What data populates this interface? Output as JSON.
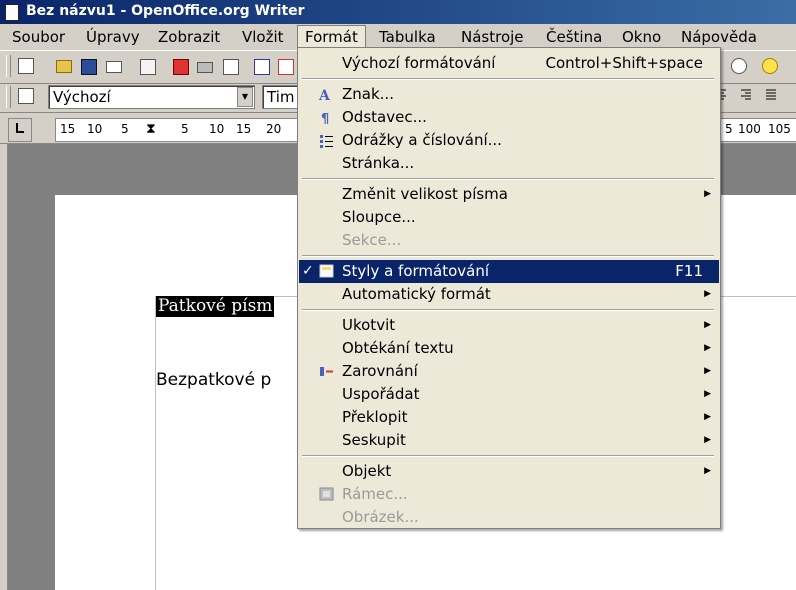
{
  "window": {
    "title": "Bez názvu1 - OpenOffice.org Writer"
  },
  "menubar": [
    {
      "label": "Soubor"
    },
    {
      "label": "Úpravy"
    },
    {
      "label": "Zobrazit"
    },
    {
      "label": "Vložit"
    },
    {
      "label": "Formát"
    },
    {
      "label": "Tabulka"
    },
    {
      "label": "Nástroje"
    },
    {
      "label": "Čeština"
    },
    {
      "label": "Okno"
    },
    {
      "label": "Nápověda"
    }
  ],
  "formatting": {
    "paragraph_style": "Výchozí",
    "font_name_partial": "Tim"
  },
  "ruler": {
    "ticks": [
      "15",
      "10",
      "5",
      "5",
      "10",
      "15",
      "20",
      "5",
      "100",
      "105"
    ]
  },
  "document": {
    "line1": "Patkové písm",
    "line2": "Bezpatkové p"
  },
  "format_menu": {
    "items": [
      {
        "label": "Výchozí formátování",
        "shortcut": "Control+Shift+space"
      },
      {
        "label": "Znak...",
        "icon": "character-icon"
      },
      {
        "label": "Odstavec...",
        "icon": "paragraph-icon"
      },
      {
        "label": "Odrážky a číslování...",
        "icon": "bullets-numbering-icon"
      },
      {
        "label": "Stránka..."
      },
      {
        "label": "Změnit velikost písma",
        "submenu": true
      },
      {
        "label": "Sloupce..."
      },
      {
        "label": "Sekce...",
        "disabled": true
      },
      {
        "label": "Styly a formátování",
        "shortcut": "F11",
        "checked": true,
        "selected": true,
        "icon": "styles-icon"
      },
      {
        "label": "Automatický formát",
        "submenu": true
      },
      {
        "label": "Ukotvit",
        "submenu": true
      },
      {
        "label": "Obtékání textu",
        "submenu": true
      },
      {
        "label": "Zarovnání",
        "submenu": true,
        "icon": "alignment-icon"
      },
      {
        "label": "Uspořádat",
        "submenu": true
      },
      {
        "label": "Překlopit",
        "submenu": true
      },
      {
        "label": "Seskupit",
        "submenu": true
      },
      {
        "label": "Objekt",
        "submenu": true
      },
      {
        "label": "Rámec...",
        "disabled": true,
        "icon": "frame-icon"
      },
      {
        "label": "Obrázek...",
        "disabled": true
      }
    ]
  },
  "colors": {
    "title_bar": "#0a246a",
    "selection": "#0a246a",
    "menu_bg": "#ece9d8",
    "chrome": "#d4d0c8"
  }
}
